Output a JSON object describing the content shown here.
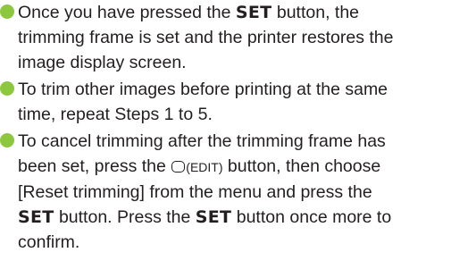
{
  "colors": {
    "bullet": "#8dc63f",
    "text": "#231f20",
    "background": "#ffffff"
  },
  "items": [
    {
      "line1_pre": "Once you have pressed the ",
      "line1_key": "SET",
      "line1_post": " button, the",
      "line2": "trimming frame is set and the printer restores the",
      "line3": "image display screen."
    },
    {
      "line1": "To trim other images before printing at the same",
      "line2": "time, repeat Steps 1 to 5."
    },
    {
      "line1": "To cancel trimming after the trimming frame has",
      "line2_pre": "been set, press the ",
      "edit_label": "(EDIT)",
      "line2_post": " button, then choose",
      "line3": "[Reset trimming] from the menu and press the",
      "line4_key": "SET",
      "line4_mid": " button. Press the ",
      "line4_key2": "SET",
      "line4_post": " button once more to",
      "line5": "confirm.",
      "icon": "edit-button-icon"
    }
  ]
}
